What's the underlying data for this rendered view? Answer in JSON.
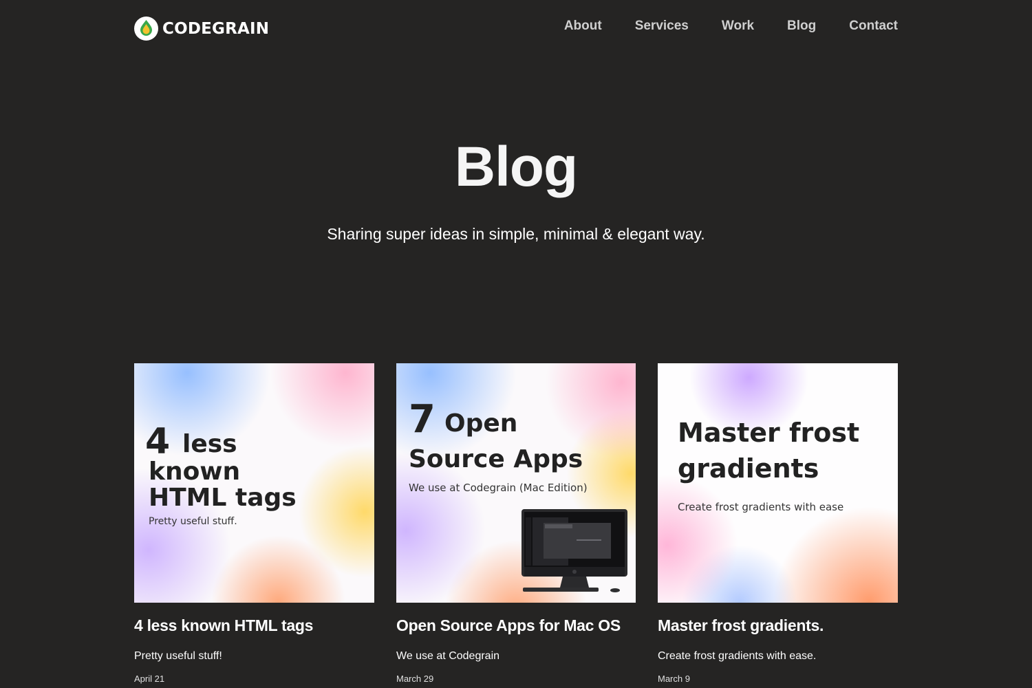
{
  "brand": {
    "name": "CODEGRAIN"
  },
  "nav": {
    "items": [
      {
        "label": "About"
      },
      {
        "label": "Services"
      },
      {
        "label": "Work"
      },
      {
        "label": "Blog"
      },
      {
        "label": "Contact"
      }
    ]
  },
  "hero": {
    "title": "Blog",
    "subtitle": "Sharing super ideas in simple, minimal & elegant way."
  },
  "posts": [
    {
      "thumb": {
        "number": "4",
        "line1": "less",
        "line2": "known",
        "line3": "HTML tags",
        "caption": "Pretty useful stuff."
      },
      "title": "4 less known HTML tags",
      "description": "Pretty useful stuff!",
      "date": "April 21"
    },
    {
      "thumb": {
        "number": "7",
        "line1": "Open",
        "line2": "Source Apps",
        "caption": "We use at Codegrain (Mac Edition)"
      },
      "title": "Open Source Apps for Mac OS",
      "description": "We use at Codegrain",
      "date": "March 29"
    },
    {
      "thumb": {
        "line1": "Master frost",
        "line2": "gradients",
        "caption": "Create frost gradients with ease"
      },
      "title": "Master frost gradients.",
      "description": "Create frost gradients with ease.",
      "date": "March 9"
    }
  ],
  "colors": {
    "background": "#252423",
    "text": "#ffffff",
    "nav_text": "#cfcfcf"
  }
}
